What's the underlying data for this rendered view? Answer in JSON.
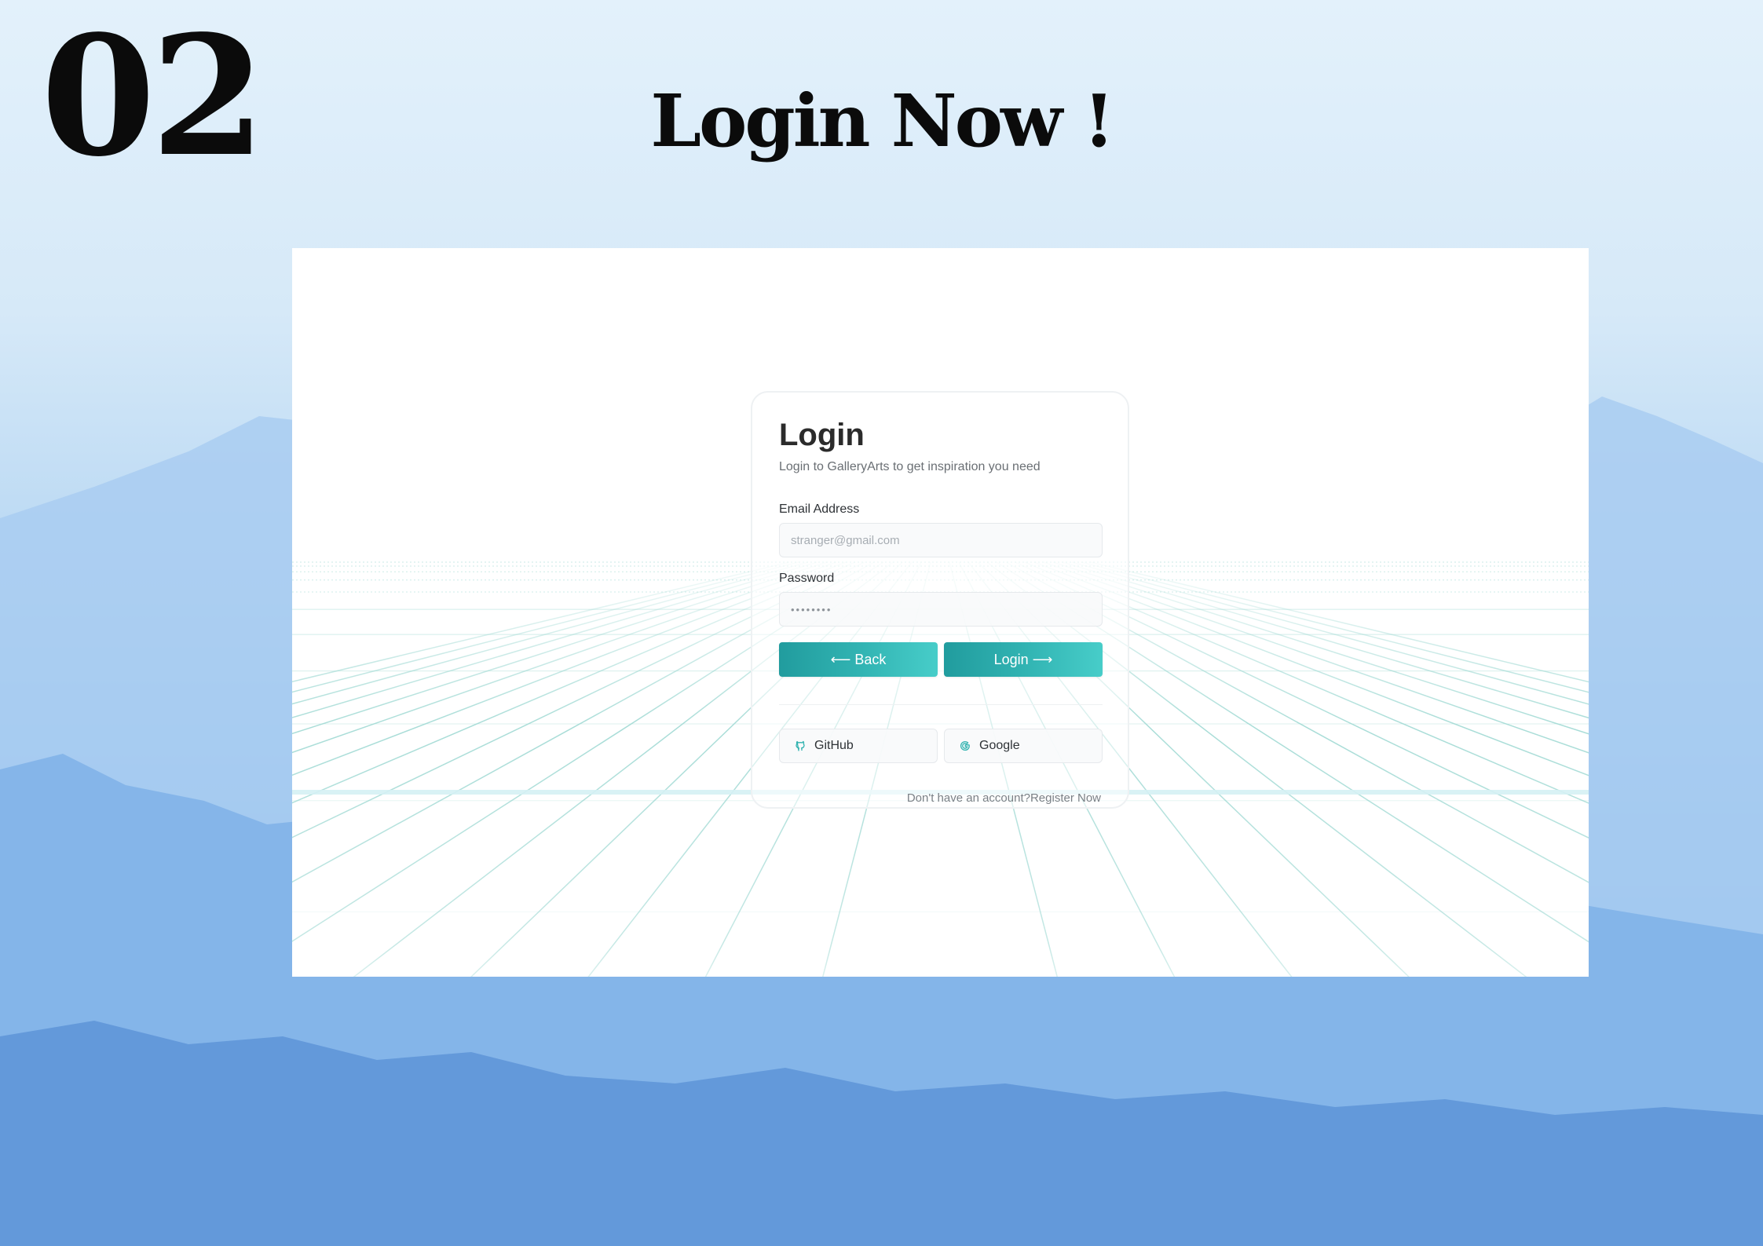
{
  "slide": {
    "number": "02",
    "title": "Login Now !"
  },
  "login": {
    "title": "Login",
    "subtitle": "Login to GalleryArts to get inspiration you need",
    "email_label": "Email Address",
    "email_placeholder": "stranger@gmail.com",
    "password_label": "Password",
    "password_value": "••••••••",
    "back_label": "⟵ Back",
    "login_label": "Login ⟶",
    "github_label": "GitHub",
    "google_label": "Google",
    "register_prompt": "Don't have an account?",
    "register_link": "Register Now"
  },
  "icons": {
    "github": "github-icon",
    "google": "google-icon"
  },
  "colors": {
    "accent_start": "#219c9e",
    "accent_end": "#47cdc9",
    "grid_line": "#9fd9d3",
    "title_text": "#0b0b0b"
  }
}
